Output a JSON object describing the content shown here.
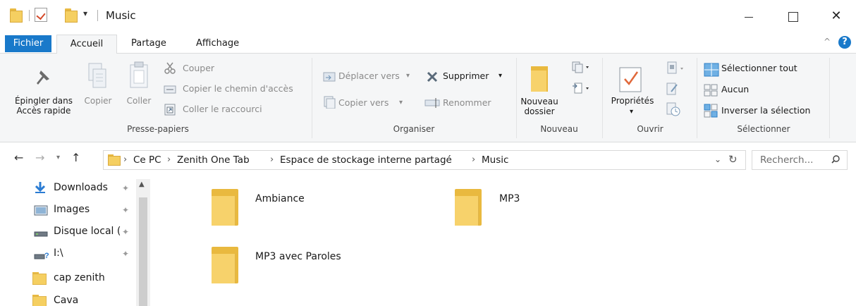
{
  "window": {
    "title": "Music",
    "quick_access_dropdown": "▾",
    "controls": {
      "minimize": "",
      "maximize": "",
      "close": "✕"
    }
  },
  "ribbon_tabs": {
    "file": "Fichier",
    "home": "Accueil",
    "share": "Partage",
    "view": "Affichage",
    "help": "?",
    "collapse": "^"
  },
  "ribbon": {
    "clipboard": {
      "pin_line1": "Épingler dans",
      "pin_line2": "Accès rapide",
      "copy": "Copier",
      "paste": "Coller",
      "cut": "Couper",
      "copy_path": "Copier le chemin d'accès",
      "paste_shortcut": "Coller le raccourci",
      "label": "Presse-papiers"
    },
    "organize": {
      "move_to": "Déplacer vers",
      "copy_to": "Copier vers",
      "delete": "Supprimer",
      "rename": "Renommer",
      "label": "Organiser"
    },
    "new": {
      "new_folder_line1": "Nouveau",
      "new_folder_line2": "dossier",
      "label": "Nouveau"
    },
    "open": {
      "properties": "Propriétés",
      "label": "Ouvrir"
    },
    "select": {
      "select_all": "Sélectionner tout",
      "select_none": "Aucun",
      "invert": "Inverser la sélection",
      "label": "Sélectionner"
    }
  },
  "address": {
    "crumbs": [
      "Ce PC",
      "Zenith One Tab",
      "Espace de stockage interne partagé",
      "Music"
    ],
    "separator": "›",
    "search_placeholder": "Recherch..."
  },
  "nav": {
    "items": [
      {
        "label": "Downloads",
        "icon": "download-icon",
        "pinned": true
      },
      {
        "label": "Images",
        "icon": "images-icon",
        "pinned": true
      },
      {
        "label": "Disque local (",
        "icon": "drive-icon",
        "pinned": true
      },
      {
        "label": "I:\\",
        "icon": "network-drive-icon",
        "pinned": true
      },
      {
        "label": "cap zenith",
        "icon": "folder-icon",
        "pinned": false
      },
      {
        "label": "Cava",
        "icon": "folder-icon",
        "pinned": false
      }
    ],
    "pin_glyph": "⚲"
  },
  "files": [
    {
      "name": "Ambiance"
    },
    {
      "name": "MP3"
    },
    {
      "name": "MP3 avec Paroles"
    }
  ],
  "colors": {
    "accent": "#1979ca",
    "folder": "#f5cf61",
    "ribbon_bg": "#f5f6f7"
  }
}
